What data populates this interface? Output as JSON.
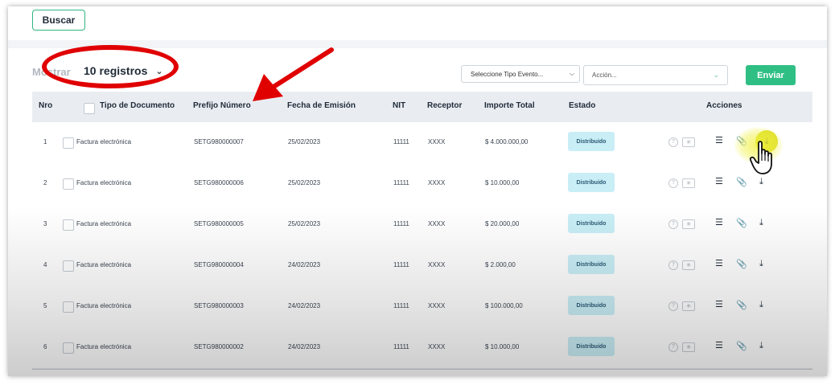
{
  "toolbar": {
    "search_button": "Buscar",
    "show_label": "Mostrar",
    "page_size": "10 registros",
    "event_type_select": "Seleccione Tipo Evento...",
    "action_select": "Acción...",
    "send_button": "Enviar"
  },
  "table": {
    "columns": [
      "Nro",
      "Tipo de Documento",
      "Prefijo Número",
      "Fecha de Emisión",
      "NIT",
      "Receptor",
      "Importe Total",
      "Estado",
      "Acciones"
    ],
    "rows": [
      {
        "nro": "1",
        "tipo": "Factura electrónica",
        "prefijo": "SETG980000007",
        "fecha": "25/02/2023",
        "nit": "11111",
        "receptor": "XXXX",
        "importe": "$ 4.000.000,00",
        "estado": "Distribuido"
      },
      {
        "nro": "2",
        "tipo": "Factura electrónica",
        "prefijo": "SETG980000006",
        "fecha": "25/02/2023",
        "nit": "11111",
        "receptor": "XXXX",
        "importe": "$ 10.000,00",
        "estado": "Distribuido"
      },
      {
        "nro": "3",
        "tipo": "Factura electrónica",
        "prefijo": "SETG980000005",
        "fecha": "25/02/2023",
        "nit": "11111",
        "receptor": "XXXX",
        "importe": "$ 20.000,00",
        "estado": "Distribuido"
      },
      {
        "nro": "4",
        "tipo": "Factura electrónica",
        "prefijo": "SETG980000004",
        "fecha": "24/02/2023",
        "nit": "11111",
        "receptor": "XXXX",
        "importe": "$ 2.000,00",
        "estado": "Distribuido"
      },
      {
        "nro": "5",
        "tipo": "Factura electrónica",
        "prefijo": "SETG980000003",
        "fecha": "24/02/2023",
        "nit": "11111",
        "receptor": "XXXX",
        "importe": "$ 100.000,00",
        "estado": "Distribuido"
      },
      {
        "nro": "6",
        "tipo": "Factura electrónica",
        "prefijo": "SETG980000002",
        "fecha": "24/02/2023",
        "nit": "11111",
        "receptor": "XXXX",
        "importe": "$ 10.000,00",
        "estado": "Distribuido"
      }
    ]
  },
  "icons": {
    "help": "question-circle-icon",
    "preview": "eye-card-icon",
    "list": "list-icon",
    "attachment": "paperclip-icon",
    "download": "download-icon"
  },
  "colors": {
    "accent_green": "#2fbf84",
    "status_badge": "#c9eef6",
    "annotation_red": "#e00000",
    "highlight_yellow": "#dede32"
  }
}
